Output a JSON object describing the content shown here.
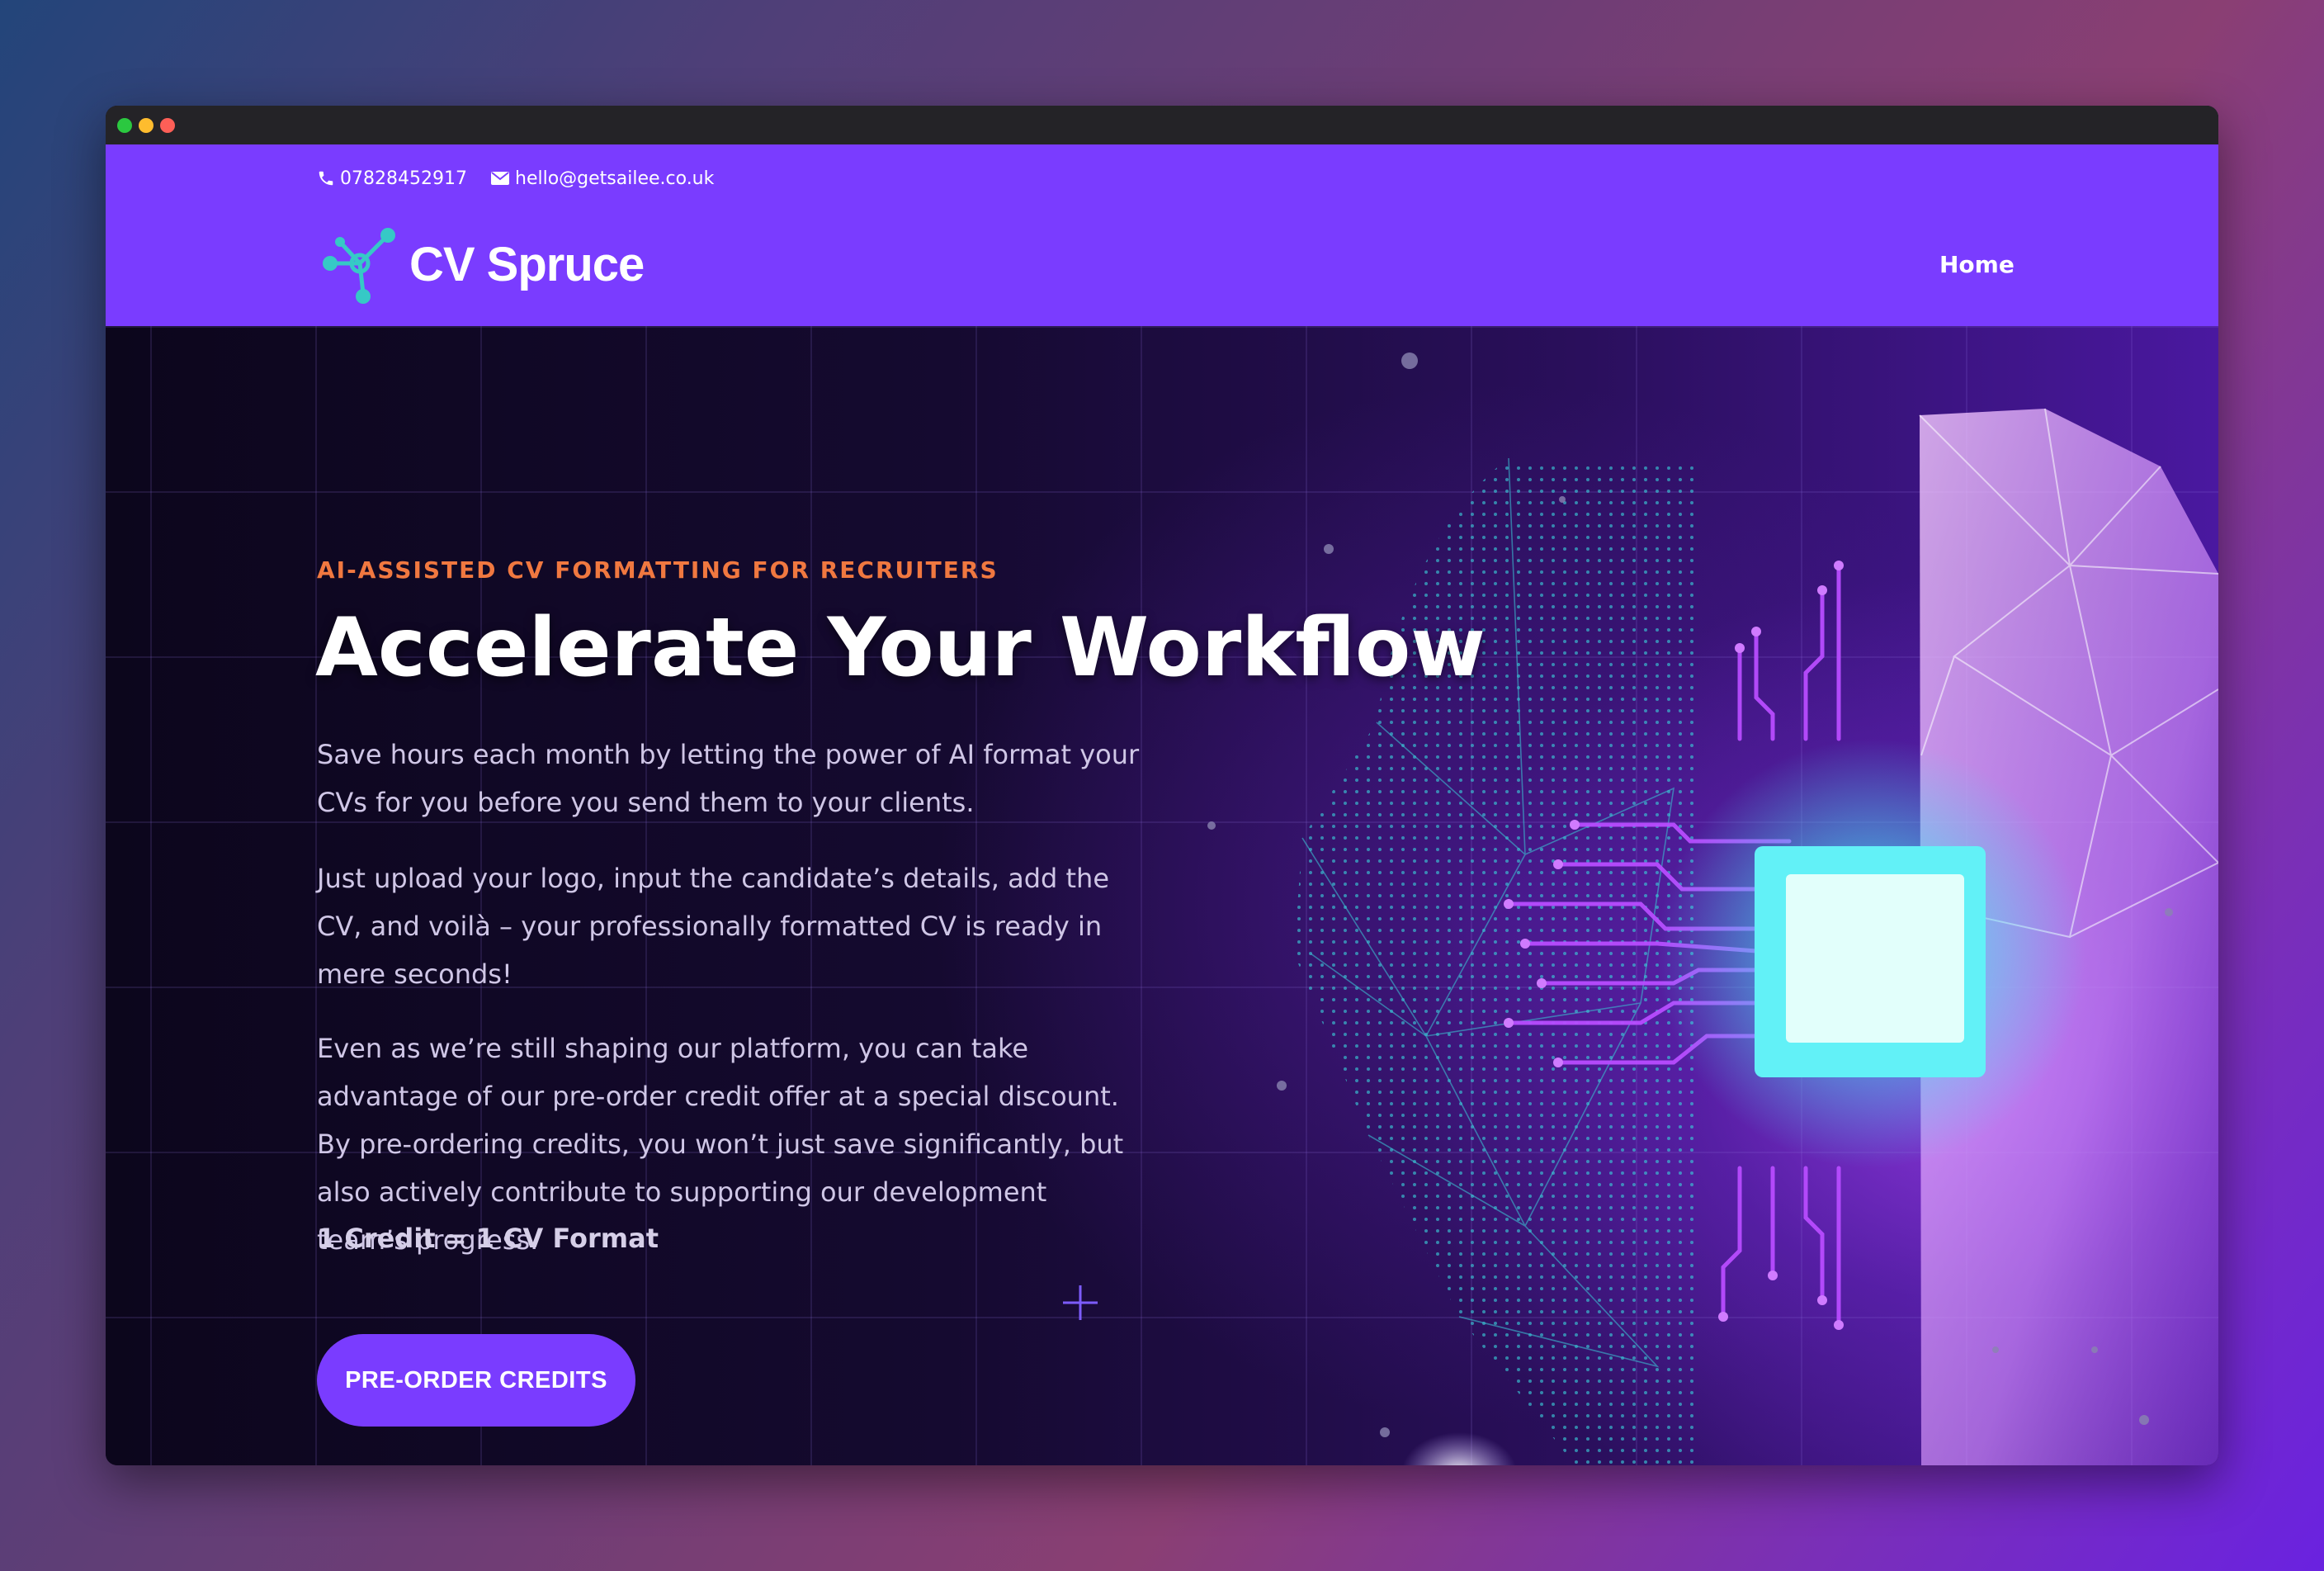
{
  "header": {
    "phone": "07828452917",
    "email": "hello@getsailee.co.uk",
    "brand": "CV Spruce",
    "nav": {
      "home": "Home"
    }
  },
  "hero": {
    "eyebrow": "AI-ASSISTED CV FORMATTING FOR RECRUITERS",
    "headline": "Accelerate Your Workflow",
    "paragraph_1": "Save hours each month by letting the power of AI format your CVs for you before you send them to your clients.",
    "paragraph_2": "Just upload your logo, input the candidate’s details, add the CV, and voilà – your professionally formatted CV is ready in mere seconds!",
    "paragraph_3": "Even as we’re still shaping our platform, you can take advantage of our pre-order credit offer at a special discount. By pre-ordering credits, you won’t just save significantly, but also actively contribute to supporting our development team’s progress.",
    "credit_note": "1 Credit = 1 CV Format",
    "cta": "PRE-ORDER CREDITS"
  },
  "colors": {
    "brand_purple": "#7a3cff",
    "eyebrow_orange": "#f07840",
    "logo_teal": "#36c9c6"
  },
  "icons": [
    "phone-icon",
    "mail-icon",
    "molecule-logo-icon",
    "plus-icon"
  ]
}
